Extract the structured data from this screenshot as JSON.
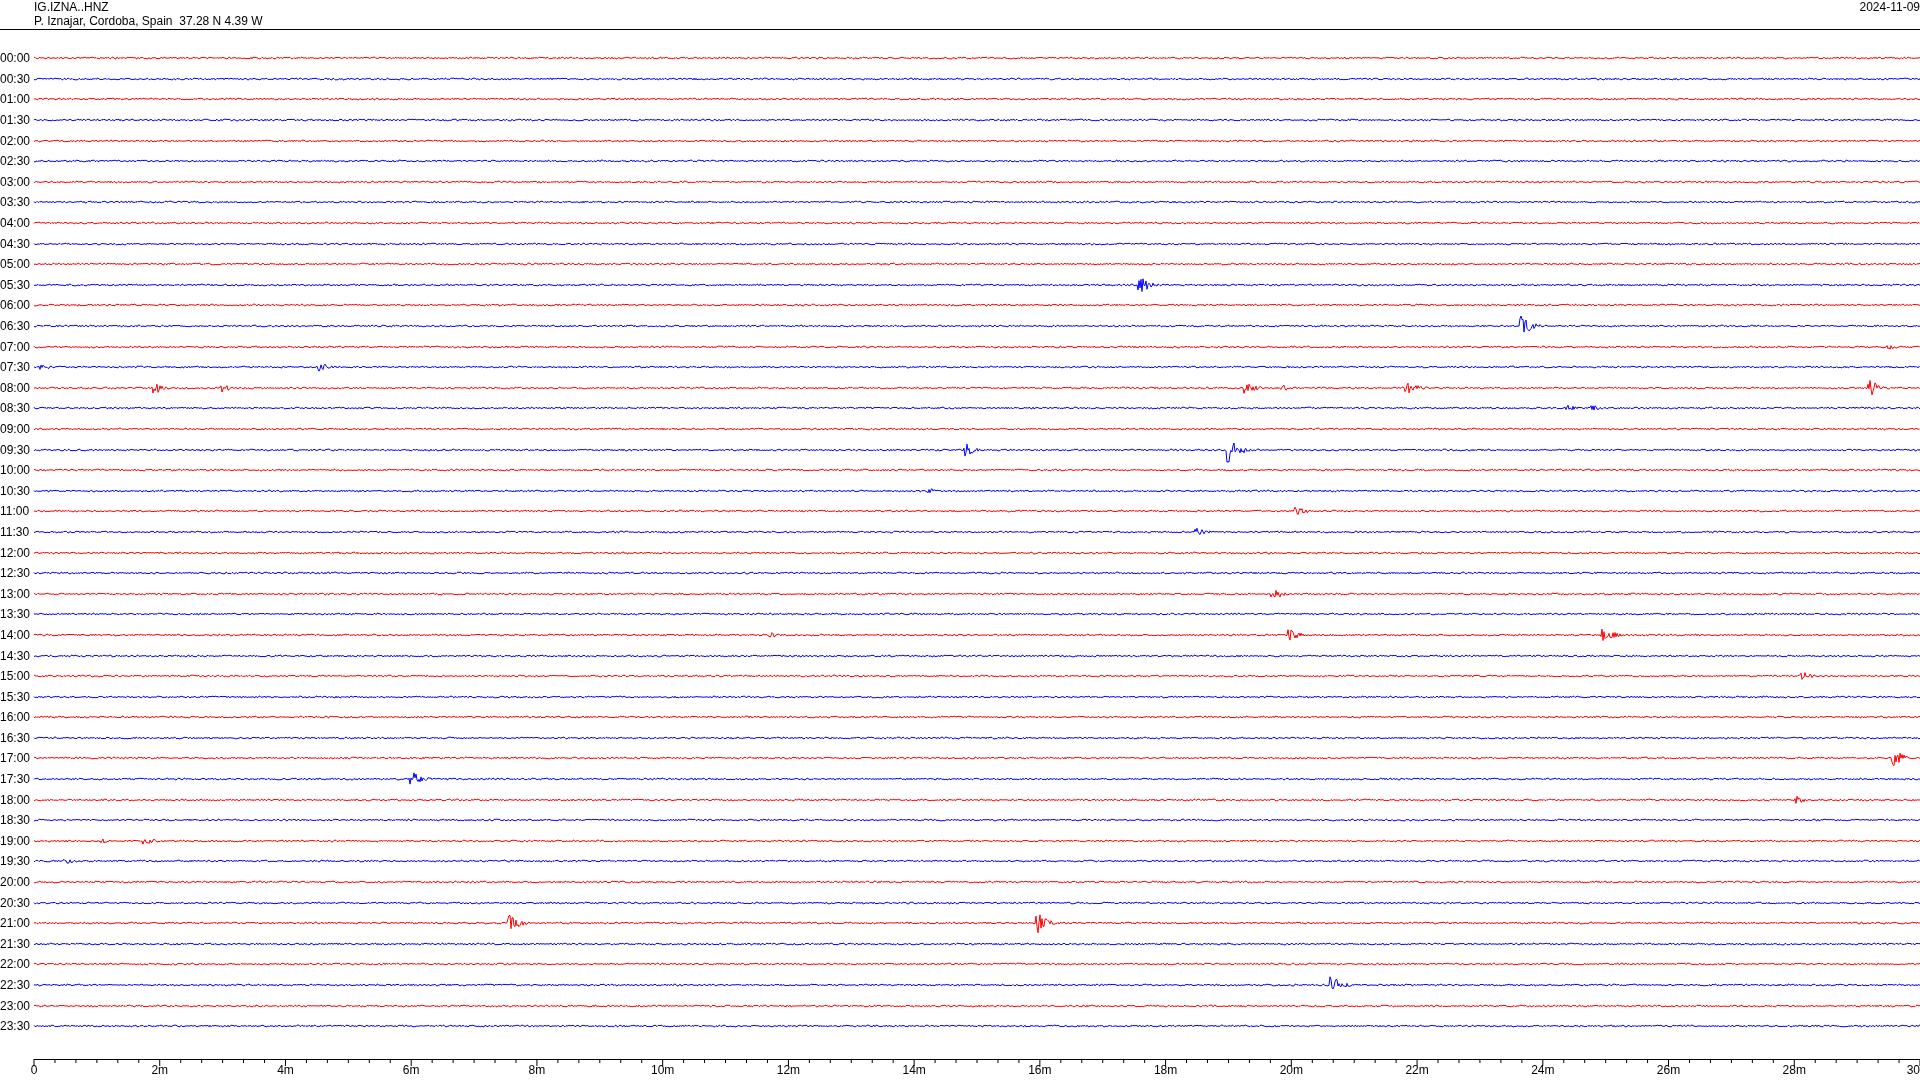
{
  "header": {
    "station": "IG.IZNA..HNZ",
    "location": "P. Iznajar, Cordoba, Spain  37.28 N 4.39 W",
    "date": "2024-11-09"
  },
  "rows": [
    {
      "time": "00:00",
      "color": "#ff0000"
    },
    {
      "time": "00:30",
      "color": "#0000ff"
    },
    {
      "time": "01:00",
      "color": "#ff0000"
    },
    {
      "time": "01:30",
      "color": "#0000ff"
    },
    {
      "time": "02:00",
      "color": "#ff0000"
    },
    {
      "time": "02:30",
      "color": "#0000ff"
    },
    {
      "time": "03:00",
      "color": "#ff0000"
    },
    {
      "time": "03:30",
      "color": "#0000ff"
    },
    {
      "time": "04:00",
      "color": "#ff0000"
    },
    {
      "time": "04:30",
      "color": "#0000ff"
    },
    {
      "time": "05:00",
      "color": "#ff0000"
    },
    {
      "time": "05:30",
      "color": "#0000ff"
    },
    {
      "time": "06:00",
      "color": "#ff0000"
    },
    {
      "time": "06:30",
      "color": "#0000ff"
    },
    {
      "time": "07:00",
      "color": "#ff0000"
    },
    {
      "time": "07:30",
      "color": "#0000ff"
    },
    {
      "time": "08:00",
      "color": "#ff0000"
    },
    {
      "time": "08:30",
      "color": "#0000ff"
    },
    {
      "time": "09:00",
      "color": "#ff0000"
    },
    {
      "time": "09:30",
      "color": "#0000ff"
    },
    {
      "time": "10:00",
      "color": "#ff0000"
    },
    {
      "time": "10:30",
      "color": "#0000ff"
    },
    {
      "time": "11:00",
      "color": "#ff0000"
    },
    {
      "time": "11:30",
      "color": "#0000ff"
    },
    {
      "time": "12:00",
      "color": "#ff0000"
    },
    {
      "time": "12:30",
      "color": "#0000ff"
    },
    {
      "time": "13:00",
      "color": "#ff0000"
    },
    {
      "time": "13:30",
      "color": "#0000ff"
    },
    {
      "time": "14:00",
      "color": "#ff0000"
    },
    {
      "time": "14:30",
      "color": "#0000ff"
    },
    {
      "time": "15:00",
      "color": "#ff0000"
    },
    {
      "time": "15:30",
      "color": "#0000ff"
    },
    {
      "time": "16:00",
      "color": "#ff0000"
    },
    {
      "time": "16:30",
      "color": "#0000ff"
    },
    {
      "time": "17:00",
      "color": "#ff0000"
    },
    {
      "time": "17:30",
      "color": "#0000ff"
    },
    {
      "time": "18:00",
      "color": "#ff0000"
    },
    {
      "time": "18:30",
      "color": "#0000ff"
    },
    {
      "time": "19:00",
      "color": "#ff0000"
    },
    {
      "time": "19:30",
      "color": "#0000ff"
    },
    {
      "time": "20:00",
      "color": "#ff0000"
    },
    {
      "time": "20:30",
      "color": "#0000ff"
    },
    {
      "time": "21:00",
      "color": "#ff0000"
    },
    {
      "time": "21:30",
      "color": "#0000ff"
    },
    {
      "time": "22:00",
      "color": "#ff0000"
    },
    {
      "time": "22:30",
      "color": "#0000ff"
    },
    {
      "time": "23:00",
      "color": "#ff0000"
    },
    {
      "time": "23:30",
      "color": "#0000ff"
    }
  ],
  "axis": {
    "ticks": [
      "0",
      "2m",
      "4m",
      "6m",
      "8m",
      "10m",
      "12m",
      "14m",
      "16m",
      "18m",
      "20m",
      "22m",
      "24m",
      "26m",
      "28m",
      "30"
    ]
  }
}
